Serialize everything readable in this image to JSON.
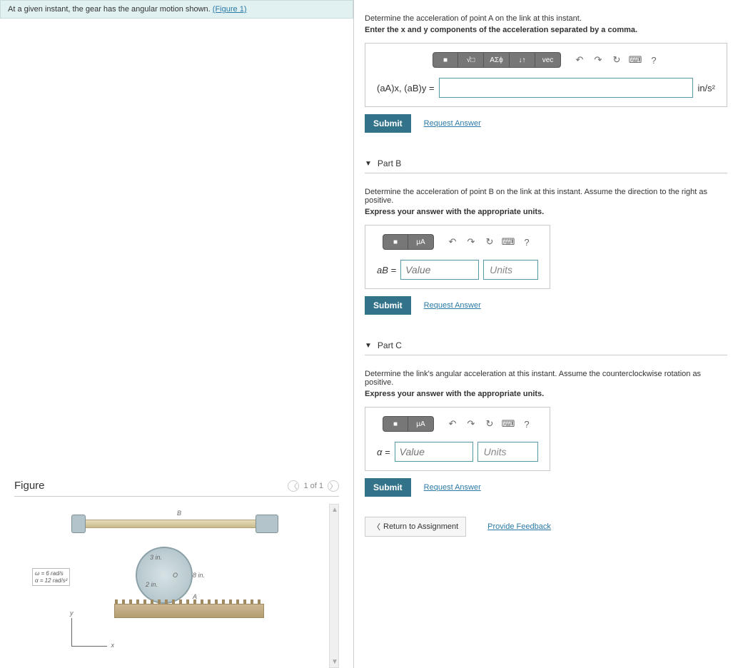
{
  "intro": {
    "text_prefix": "At a given instant, the gear has the angular motion shown.",
    "figure_link": "(Figure 1)"
  },
  "figure": {
    "title": "Figure",
    "pager": "1 of 1",
    "omega": "ω = 6 rad/s",
    "alpha": "α = 12 rad/s²",
    "dim3": "3 in.",
    "dim2": "2 in.",
    "dim8": "8 in.",
    "ptA": "A",
    "ptB": "B",
    "ptO": "O",
    "axisX": "x",
    "axisY": "y"
  },
  "partA": {
    "prompt": "Determine the acceleration of point A on the link at this instant.",
    "bold": "Enter the x and y components of the acceleration separated by a comma.",
    "label": "(aA)x, (aB)y =",
    "unit": "in/s²",
    "submit": "Submit",
    "request": "Request Answer",
    "tools": {
      "sqrt": "√□",
      "greek": "ΑΣϕ",
      "arrows": "↓↑",
      "vec": "vec"
    }
  },
  "partB": {
    "header": "Part B",
    "prompt": "Determine the acceleration of point B on the link at this instant. Assume the direction to the right as positive.",
    "bold": "Express your answer with the appropriate units.",
    "label": "aB =",
    "value_ph": "Value",
    "units_ph": "Units",
    "submit": "Submit",
    "request": "Request Answer",
    "tools": {
      "frac": "□",
      "mu": "μA"
    }
  },
  "partC": {
    "header": "Part C",
    "prompt": "Determine the link's angular acceleration at this instant. Assume the counterclockwise rotation as positive.",
    "bold": "Express your answer with the appropriate units.",
    "label": "α =",
    "value_ph": "Value",
    "units_ph": "Units",
    "submit": "Submit",
    "request": "Request Answer"
  },
  "footer": {
    "return": "Return to Assignment",
    "feedback": "Provide Feedback"
  },
  "common_tools": {
    "undo": "↶",
    "redo": "↷",
    "reset": "↻",
    "keyboard": "⌨",
    "help": "?"
  }
}
